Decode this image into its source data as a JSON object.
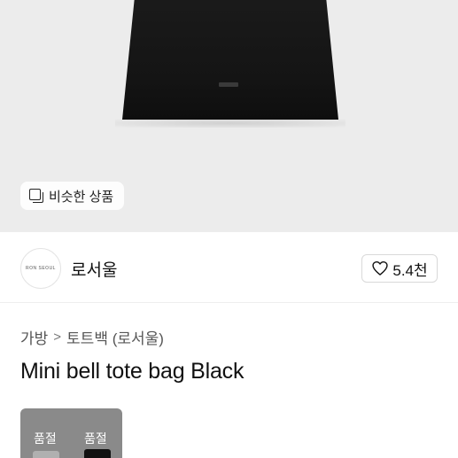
{
  "similar_products": {
    "label": "비슷한 상품",
    "icon": "copy-icon"
  },
  "brand": {
    "logo_text": "RON SEOUL",
    "name": "로서울"
  },
  "like": {
    "icon": "heart-icon",
    "count": "5.4천"
  },
  "breadcrumb": {
    "items": [
      "가방",
      "토트백 (로서울)"
    ],
    "separator": ">"
  },
  "product": {
    "title": "Mini bell tote bag Black"
  },
  "variants": [
    {
      "status": "품절",
      "color": "grey"
    },
    {
      "status": "품절",
      "color": "black"
    }
  ]
}
